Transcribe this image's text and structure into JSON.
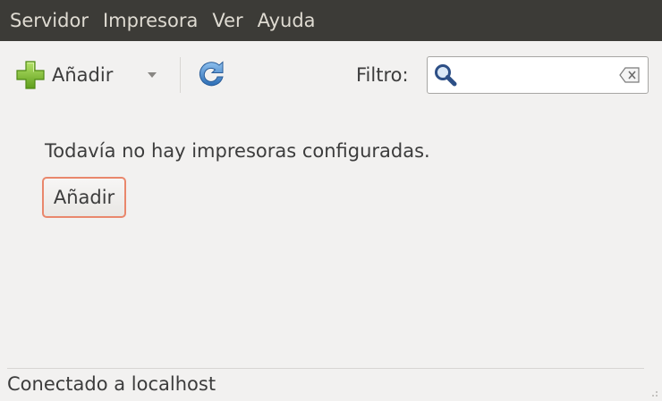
{
  "menubar": {
    "items": [
      {
        "label": "Servidor"
      },
      {
        "label": "Impresora"
      },
      {
        "label": "Ver"
      },
      {
        "label": "Ayuda"
      }
    ]
  },
  "toolbar": {
    "add_label": "Añadir",
    "filter_label": "Filtro:",
    "filter_value": "",
    "icons": {
      "add": "plus-icon",
      "dropdown": "chevron-down-icon",
      "refresh": "refresh-icon",
      "search": "search-icon",
      "clear": "clear-icon"
    }
  },
  "main": {
    "empty_message": "Todavía no hay impresoras configuradas.",
    "add_button_label": "Añadir"
  },
  "statusbar": {
    "text": "Conectado a localhost"
  },
  "colors": {
    "menubar_bg": "#3c3b37",
    "menubar_text": "#dfdbd2",
    "window_bg": "#f2f1f0",
    "focus_border": "#e9876c",
    "add_icon_green": "#7bbf2a",
    "refresh_blue": "#3d7fc8"
  }
}
